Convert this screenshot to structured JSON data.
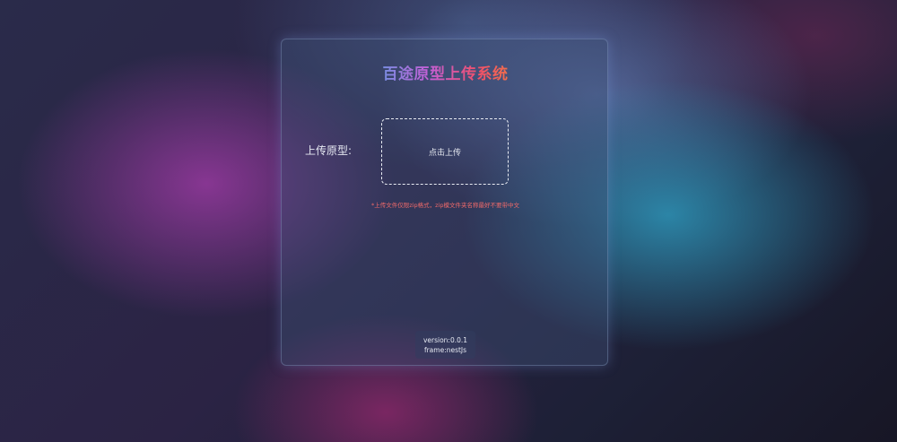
{
  "title": "百途原型上传系统",
  "upload": {
    "label": "上传原型:",
    "button_text": "点击上传",
    "notice": "*上传文件仅限zip格式，zip模文件夹名称最好不要带中文"
  },
  "footer": {
    "version": "version:0.0.1",
    "frame": "frame:nestJs"
  }
}
